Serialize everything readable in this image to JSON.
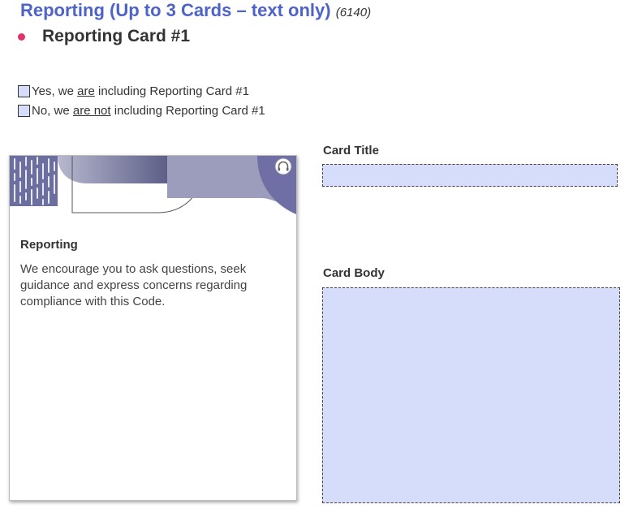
{
  "heading": {
    "title": "Reporting (Up to 3 Cards – text only)",
    "code": "(6140)"
  },
  "subheading": "Reporting Card #1",
  "options": {
    "yes": {
      "pre": "Yes, we ",
      "emph": "are",
      "post": " including Reporting Card #1"
    },
    "no": {
      "pre": "No, we ",
      "emph": "are not",
      "post": " including Reporting Card #1"
    }
  },
  "card": {
    "title": "Reporting",
    "body": "We encourage you to ask questions, seek guidance and express concerns regarding compliance with this Code."
  },
  "fields": {
    "title_label": "Card Title",
    "title_value": "",
    "body_label": "Card Body",
    "body_value": ""
  },
  "colors": {
    "heading": "#4d63c7",
    "bullet": "#e0336a",
    "field_fill": "#d6ddfb",
    "card_art": "#6b6e9e"
  },
  "icons": {
    "card_corner": "headphones-icon"
  }
}
